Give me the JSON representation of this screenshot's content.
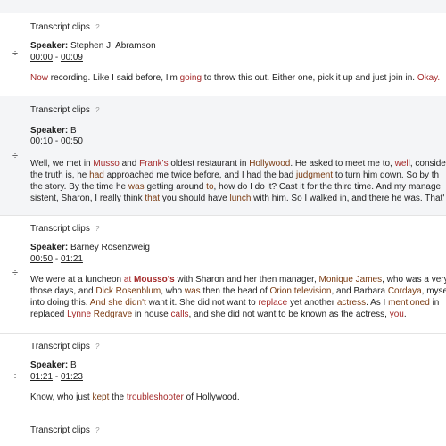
{
  "section_label": "Transcript clips",
  "help_glyph": "?",
  "speaker_label": "Speaker:",
  "time_separator": "-",
  "drag_glyph": "÷",
  "clips": [
    {
      "speaker": "Stephen J. Abramson",
      "start": "00:00",
      "end": "00:09",
      "lines": [
        [
          [
            "hl",
            "Now"
          ],
          [
            "n",
            " recording. Like I said before, I'm "
          ],
          [
            "hl",
            "going"
          ],
          [
            "n",
            " to throw this out. Either one, pick it up and just join in. "
          ],
          [
            "hl",
            "Okay."
          ]
        ]
      ]
    },
    {
      "speaker": "B",
      "start": "00:10",
      "end": "00:50",
      "lines": [
        [
          [
            "n",
            "Well, we met in "
          ],
          [
            "hl",
            "Musso"
          ],
          [
            "n",
            " and "
          ],
          [
            "hl",
            "Frank's"
          ],
          [
            "n",
            " oldest restaurant in "
          ],
          [
            "ck",
            "Hollywood"
          ],
          [
            "n",
            ". He asked to meet me to, "
          ],
          [
            "hl",
            "well"
          ],
          [
            "n",
            ", conside"
          ]
        ],
        [
          [
            "n",
            "the truth is, he "
          ],
          [
            "ck",
            "had"
          ],
          [
            "n",
            " approached me twice before, and I had the bad "
          ],
          [
            "ck",
            "judgment"
          ],
          [
            "n",
            " to turn him down. So by th"
          ]
        ],
        [
          [
            "n",
            "the story. By the time he "
          ],
          [
            "ck",
            "was"
          ],
          [
            "n",
            " getting around "
          ],
          [
            "ck",
            "to"
          ],
          [
            "n",
            ", how do I do it? Cast it for the third time. And my manage"
          ]
        ],
        [
          [
            "n",
            "sistent, Sharon, I really think "
          ],
          [
            "ck",
            "that"
          ],
          [
            "n",
            " you should have "
          ],
          [
            "ck",
            "lunch"
          ],
          [
            "n",
            " with him. So I walked in, and there he was. That'"
          ]
        ]
      ]
    },
    {
      "speaker": "Barney Rosenzweig",
      "start": "00:50",
      "end": "01:21",
      "lines": [
        [
          [
            "n",
            "We were at a luncheon "
          ],
          [
            "hl",
            "at"
          ],
          [
            "n",
            " "
          ],
          [
            "hlb",
            "Mousso's"
          ],
          [
            "n",
            " with Sharon and her then manager, "
          ],
          [
            "ck",
            "Monique James"
          ],
          [
            "n",
            ", who was a very"
          ]
        ],
        [
          [
            "n",
            "those days, and "
          ],
          [
            "ck",
            "Dick Rosenblum"
          ],
          [
            "n",
            ", who "
          ],
          [
            "ck",
            "was"
          ],
          [
            "n",
            " then the head of "
          ],
          [
            "ck",
            "Orion television"
          ],
          [
            "n",
            ", and Barbara "
          ],
          [
            "ck",
            "Cordaya"
          ],
          [
            "n",
            ", myse"
          ]
        ],
        [
          [
            "n",
            "into doing this. "
          ],
          [
            "ck",
            "And"
          ],
          [
            "n",
            " "
          ],
          [
            "ck",
            "she"
          ],
          [
            "n",
            " "
          ],
          [
            "ck",
            "didn't"
          ],
          [
            "n",
            " want it. She did not want to "
          ],
          [
            "hl",
            "replace"
          ],
          [
            "n",
            " yet another "
          ],
          [
            "ck",
            "actress"
          ],
          [
            "n",
            ". As I "
          ],
          [
            "ck",
            "mentioned"
          ],
          [
            "n",
            " in"
          ]
        ],
        [
          [
            "n",
            "replaced "
          ],
          [
            "hl",
            "Lynne"
          ],
          [
            "n",
            " "
          ],
          [
            "ck",
            "Redgrave"
          ],
          [
            "n",
            " in house "
          ],
          [
            "hl",
            "calls"
          ],
          [
            "n",
            ", and she did not want to be known as the actress, "
          ],
          [
            "hl",
            "you"
          ],
          [
            "n",
            "."
          ]
        ]
      ]
    },
    {
      "speaker": "B",
      "start": "01:21",
      "end": "01:23",
      "lines": [
        [
          [
            "n",
            "Know, who just "
          ],
          [
            "ck",
            "kept"
          ],
          [
            "n",
            " the "
          ],
          [
            "hl",
            "troubleshooter"
          ],
          [
            "n",
            " of Hollywood."
          ]
        ]
      ]
    }
  ]
}
